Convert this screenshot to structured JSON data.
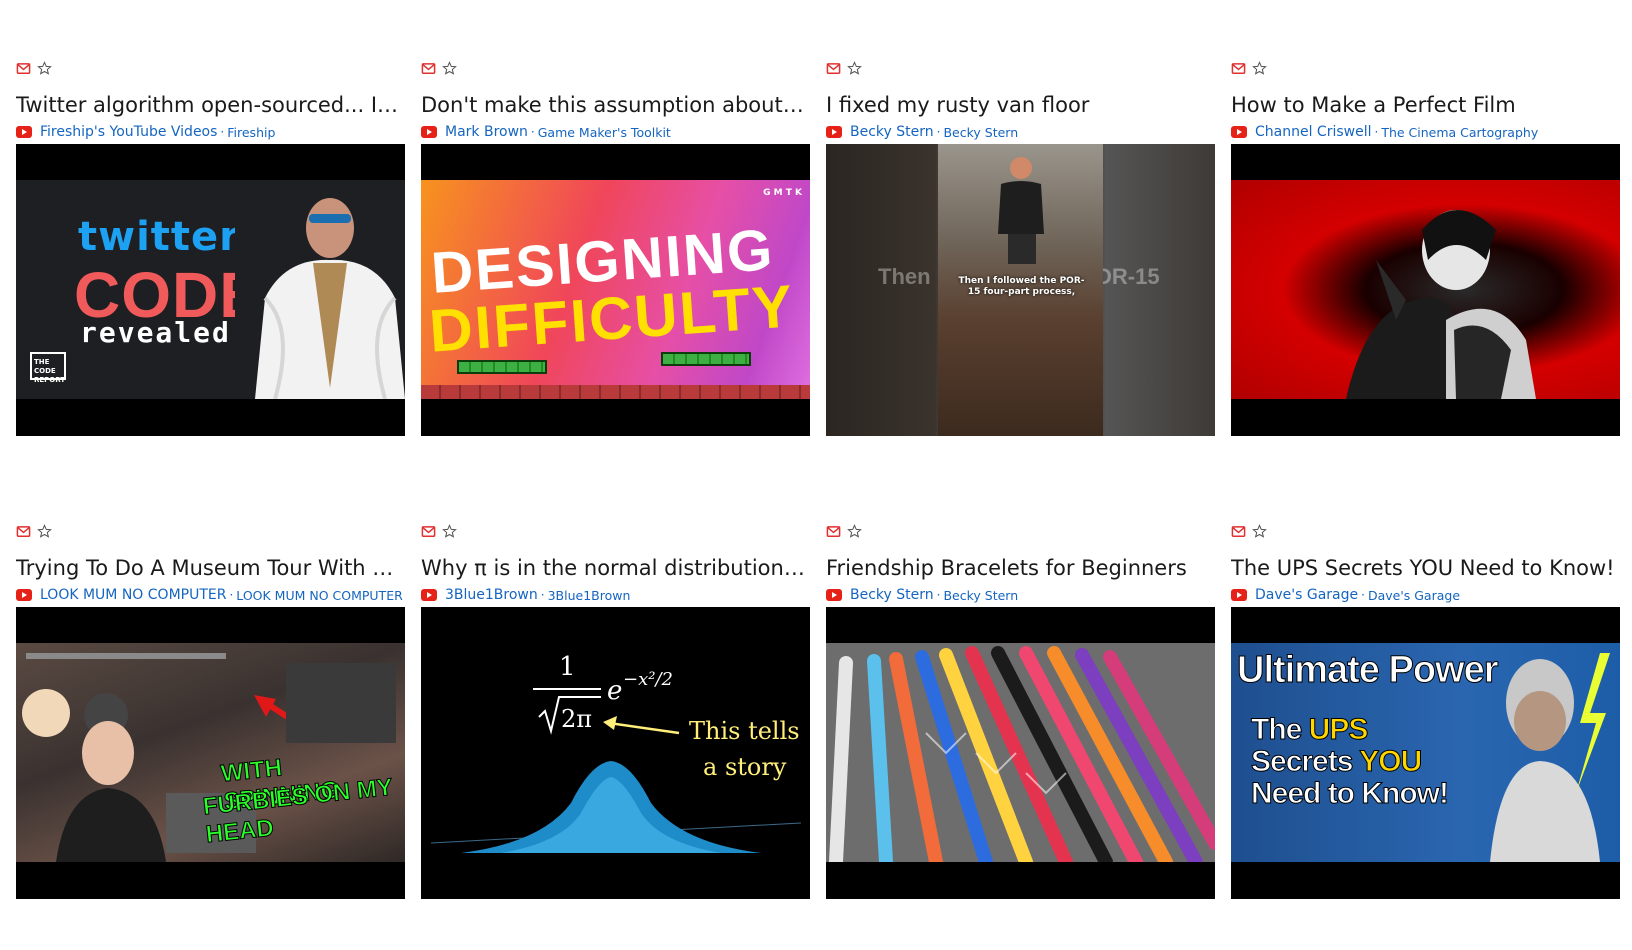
{
  "videos": [
    {
      "title": "Twitter algorithm open-sourced... Is Elon",
      "channel": "Fireship's YouTube Videos",
      "subscription": "Fireship",
      "thumb": {
        "line1": "twitter",
        "line2": "CODE",
        "line3": "revealed",
        "badge": "THE CODE REPORT"
      }
    },
    {
      "title": "Don't make this assumption about your game",
      "channel": "Mark Brown",
      "subscription": "Game Maker's Toolkit",
      "thumb": {
        "line1": "DESIGNING",
        "line2": "DIFFICULTY",
        "badge": "G M T K"
      }
    },
    {
      "title": "I fixed my rusty van floor",
      "channel": "Becky Stern",
      "subscription": "Becky Stern",
      "thumb": {
        "caption": "Then I followed the POR-15 four-part process,",
        "left_ghost": "Then",
        "right_ghost": "DR-15"
      }
    },
    {
      "title": "How to Make a Perfect Film",
      "channel": "Channel Criswell",
      "subscription": "The Cinema Cartography",
      "thumb": {}
    },
    {
      "title": "Trying To Do A Museum Tour With a Furby",
      "channel": "LOOK MUM NO COMPUTER",
      "subscription": "LOOK MUM NO COMPUTER",
      "thumb": {
        "line1": "WITH SPINNING",
        "line2": "FURBIES ON MY HEAD"
      }
    },
    {
      "title": "Why π is in the normal distribution (beyond",
      "channel": "3Blue1Brown",
      "subscription": "3Blue1Brown",
      "thumb": {
        "line1": "This tells",
        "line2": "a story"
      }
    },
    {
      "title": "Friendship Bracelets for Beginners",
      "channel": "Becky Stern",
      "subscription": "Becky Stern",
      "thumb": {}
    },
    {
      "title": "The UPS Secrets YOU Need to Know!",
      "channel": "Dave's Garage",
      "subscription": "Dave's Garage",
      "thumb": {
        "line1": "Ultimate Power",
        "line2a": "The ",
        "line2b": "UPS",
        "line3a": "Secrets ",
        "line3b": "YOU",
        "line4": "Need to Know!"
      }
    }
  ],
  "colors": {
    "accent_red": "#e62117",
    "link_blue": "#1565c0",
    "title_text": "#1a1a1a"
  },
  "icons": {
    "mail": "mail-icon",
    "star": "star-outline-icon",
    "source": "youtube-icon"
  }
}
